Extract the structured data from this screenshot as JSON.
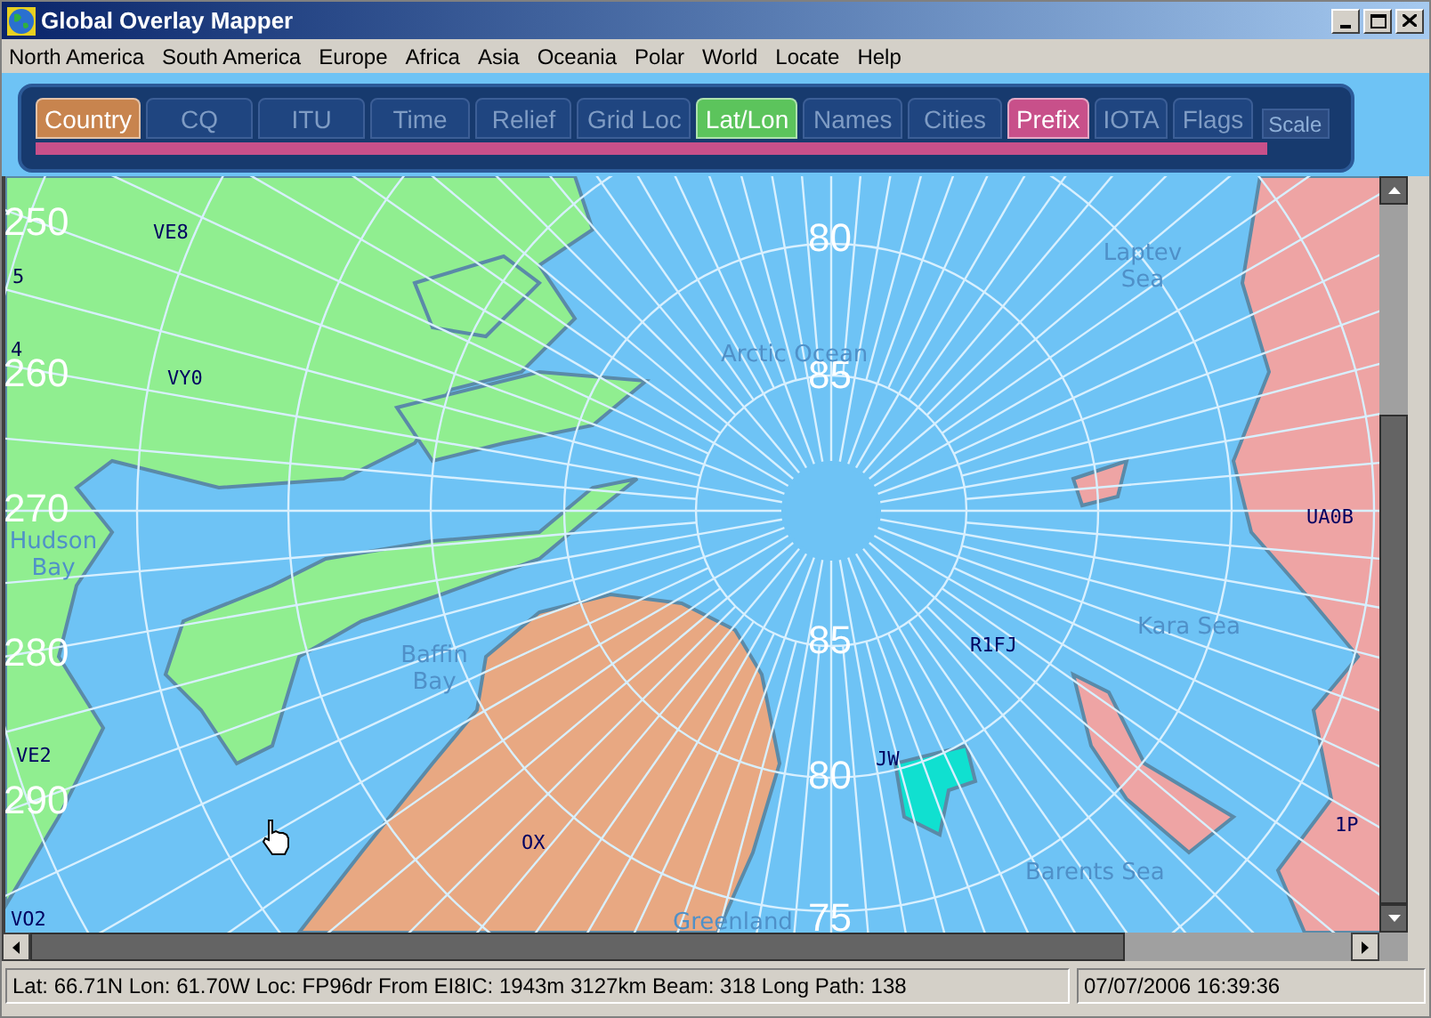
{
  "window": {
    "title": "Global Overlay Mapper"
  },
  "menu": [
    "North America",
    "South America",
    "Europe",
    "Africa",
    "Asia",
    "Oceania",
    "Polar",
    "World",
    "Locate",
    "Help"
  ],
  "tabs": [
    {
      "label": "Country",
      "on": true,
      "color": "#c8844e"
    },
    {
      "label": "CQ",
      "on": false
    },
    {
      "label": "ITU",
      "on": false
    },
    {
      "label": "Time",
      "on": false
    },
    {
      "label": "Relief",
      "on": false
    },
    {
      "label": "Grid Loc",
      "on": false
    },
    {
      "label": "Lat/Lon",
      "on": true,
      "color": "#5cc45c"
    },
    {
      "label": "Names",
      "on": false
    },
    {
      "label": "Cities",
      "on": false
    },
    {
      "label": "Prefix",
      "on": true,
      "color": "#c8508a"
    },
    {
      "label": "IOTA",
      "on": false
    },
    {
      "label": "Flags",
      "on": false
    }
  ],
  "scale_button": "Scale",
  "map": {
    "labels": [
      {
        "text": "250",
        "kind": "degree"
      },
      {
        "text": "260",
        "kind": "degree"
      },
      {
        "text": "270",
        "kind": "degree"
      },
      {
        "text": "280",
        "kind": "degree"
      },
      {
        "text": "290",
        "kind": "degree"
      },
      {
        "text": "80",
        "kind": "degree"
      },
      {
        "text": "85",
        "kind": "degree"
      },
      {
        "text": "85",
        "kind": "degree"
      },
      {
        "text": "80",
        "kind": "degree"
      },
      {
        "text": "75",
        "kind": "degree"
      },
      {
        "text": "5",
        "kind": "zone"
      },
      {
        "text": "4",
        "kind": "zone"
      },
      {
        "text": "VE8",
        "kind": "prefix"
      },
      {
        "text": "VY0",
        "kind": "prefix"
      },
      {
        "text": "VE2",
        "kind": "prefix"
      },
      {
        "text": "VO2",
        "kind": "prefix"
      },
      {
        "text": "OX",
        "kind": "prefix"
      },
      {
        "text": "JW",
        "kind": "prefix"
      },
      {
        "text": "R1FJ",
        "kind": "prefix"
      },
      {
        "text": "UA0B",
        "kind": "prefix"
      },
      {
        "text": "1P",
        "kind": "prefix"
      },
      {
        "text": "Hudson Bay",
        "kind": "region"
      },
      {
        "text": "Baffin Bay",
        "kind": "region"
      },
      {
        "text": "Laptev Sea",
        "kind": "region"
      },
      {
        "text": "Arctic Ocean",
        "kind": "region"
      },
      {
        "text": "Kara Sea",
        "kind": "region"
      },
      {
        "text": "Barents Sea",
        "kind": "region"
      },
      {
        "text": "Greenland",
        "kind": "region"
      }
    ]
  },
  "status_bar": {
    "info": "Lat: 66.71N  Lon: 61.70W  Loc: FP96dr  From EI8IC: 1943m  3127km  Beam: 318  Long Path: 138",
    "datetime": "07/07/2006 16:39:36"
  }
}
